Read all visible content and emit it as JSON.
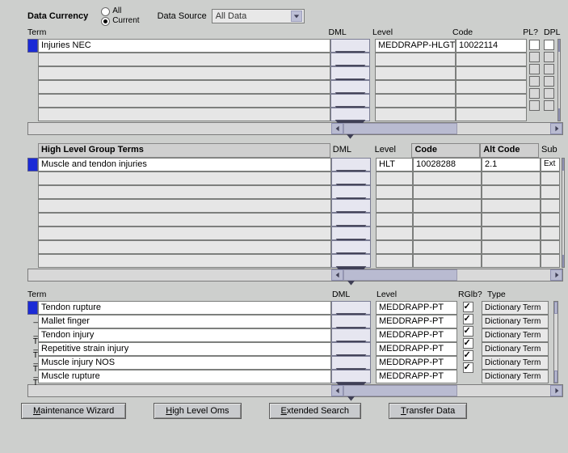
{
  "top": {
    "currency_label": "Data Currency",
    "radio_all": "All",
    "radio_current": "Current",
    "source_label": "Data Source",
    "source_value": "All Data"
  },
  "grid1": {
    "hdr_term": "Term",
    "hdr_dml": "DML",
    "hdr_level": "Level",
    "hdr_code": "Code",
    "hdr_pl": "PL?",
    "hdr_dpl": "DPL",
    "row0_term": "Injuries NEC",
    "row0_level": "MEDDRAPP-HLGT",
    "row0_code": "10022114"
  },
  "grid2": {
    "hdr_title": "High Level Group Terms",
    "hdr_dml": "DML",
    "hdr_level": "Level",
    "hdr_code": "Code",
    "hdr_alt": "Alt Code",
    "hdr_sub": "Sub",
    "row0_term": "Muscle and tendon injuries",
    "row0_level": "HLT",
    "row0_code": "10028288",
    "row0_alt": "2.1",
    "row0_sub": "Ext"
  },
  "grid3": {
    "hdr_term": "Term",
    "hdr_dml": "DML",
    "hdr_level": "Level",
    "hdr_rg": "RGlb?",
    "hdr_type": "Type",
    "level_val": "MEDDRAPP-PT",
    "type_val": "Dictionary Term",
    "r0_prefix": "",
    "r0_term": "Tendon rupture",
    "r1_prefix": "_",
    "r1_term": "Mallet finger",
    "r2_prefix": "_ T",
    "r2_term": "Tendon injury",
    "r3_prefix": "_ T",
    "r3_term": "Repetitive strain injury",
    "r4_prefix": "_ T",
    "r4_term": "Muscle injury NOS",
    "r5_prefix": "_ T",
    "r5_term": "Muscle rupture"
  },
  "buttons": {
    "b1a": "M",
    "b1b": "aintenance Wizard",
    "b2a": "H",
    "b2b": "igh Level Oms",
    "b3a": "E",
    "b3b": "xtended Search",
    "b4a": "T",
    "b4b": "ransfer Data"
  }
}
